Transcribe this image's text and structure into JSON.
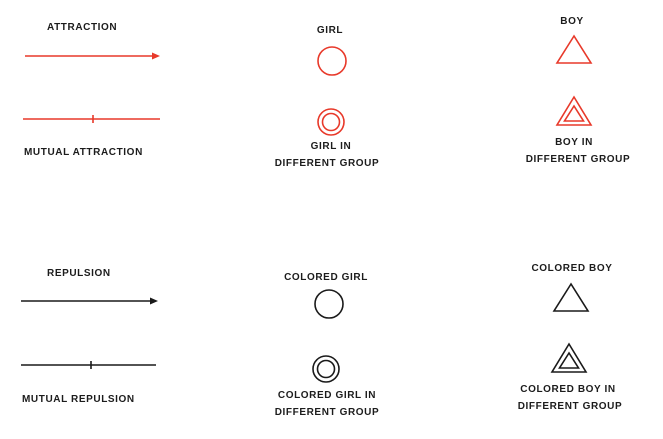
{
  "colors": {
    "red": "#e8392a",
    "black": "#1a1a1a"
  },
  "labels": {
    "attraction": "ATTRACTION",
    "mutual_attraction": "MUTUAL ATTRACTION",
    "girl": "GIRL",
    "girl_different_group_1": "GIRL IN",
    "girl_different_group_2": "DIFFERENT GROUP",
    "boy": "BOY",
    "boy_different_group_1": "BOY IN",
    "boy_different_group_2": "DIFFERENT GROUP",
    "repulsion": "REPULSION",
    "mutual_repulsion": "MUTUAL REPULSION",
    "colored_girl": "COLORED GIRL",
    "colored_girl_different_group_1": "COLORED GIRL IN",
    "colored_girl_different_group_2": "DIFFERENT GROUP",
    "colored_boy": "COLORED BOY",
    "colored_boy_different_group_1": "COLORED BOY IN",
    "colored_boy_different_group_2": "DIFFERENT GROUP"
  },
  "symbols": {
    "attraction_arrow": "arrow-icon",
    "mutual_attraction_line": "tick-line-icon",
    "girl": "circle-icon",
    "girl_different_group": "double-circle-icon",
    "boy": "triangle-icon",
    "boy_different_group": "double-triangle-icon",
    "repulsion_arrow": "arrow-icon",
    "mutual_repulsion_line": "tick-line-icon",
    "colored_girl": "circle-icon",
    "colored_girl_different_group": "double-circle-icon",
    "colored_boy": "triangle-icon",
    "colored_boy_different_group": "double-triangle-icon"
  }
}
